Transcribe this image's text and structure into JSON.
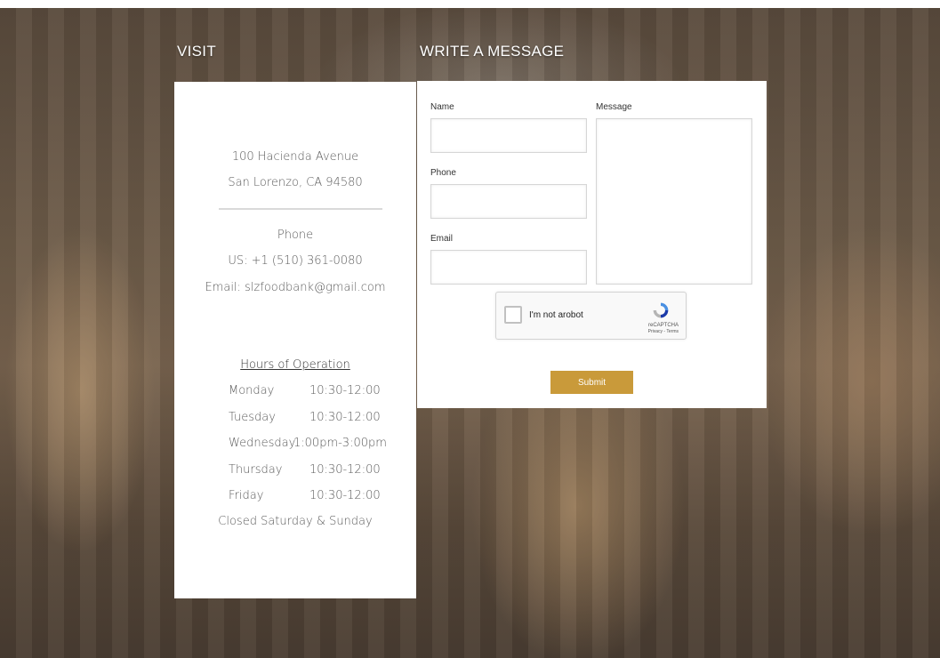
{
  "visit": {
    "title": "VISIT",
    "address_line1": "100 Hacienda Avenue",
    "address_line2": "San Lorenzo, CA 94580",
    "phone_label": "Phone",
    "phone_value": "US: +1 (510) 361-0080",
    "email": "Email: slzfoodbank@gmail.com",
    "hours_title": "Hours of Operation",
    "hours": [
      {
        "day": "Monday",
        "time": "10:30-12:00"
      },
      {
        "day": "Tuesday",
        "time": "10:30-12:00"
      },
      {
        "day": "Wednesday",
        "time": "1:00pm-3:00pm"
      },
      {
        "day": "Thursday",
        "time": "10:30-12:00"
      },
      {
        "day": "Friday",
        "time": "10:30-12:00"
      }
    ],
    "closed_note": "Closed Saturday & Sunday"
  },
  "form": {
    "title": "WRITE A MESSAGE",
    "name_label": "Name",
    "phone_label": "Phone",
    "email_label": "Email",
    "message_label": "Message",
    "name_value": "",
    "phone_value": "",
    "email_value": "",
    "message_value": "",
    "captcha_label": "I'm not arobot",
    "captcha_brand": "reCAPTCHA",
    "captcha_terms": "Privacy - Terms",
    "submit_label": "Submit"
  },
  "colors": {
    "accent": "#c99a3a",
    "panel": "#ffffff"
  }
}
